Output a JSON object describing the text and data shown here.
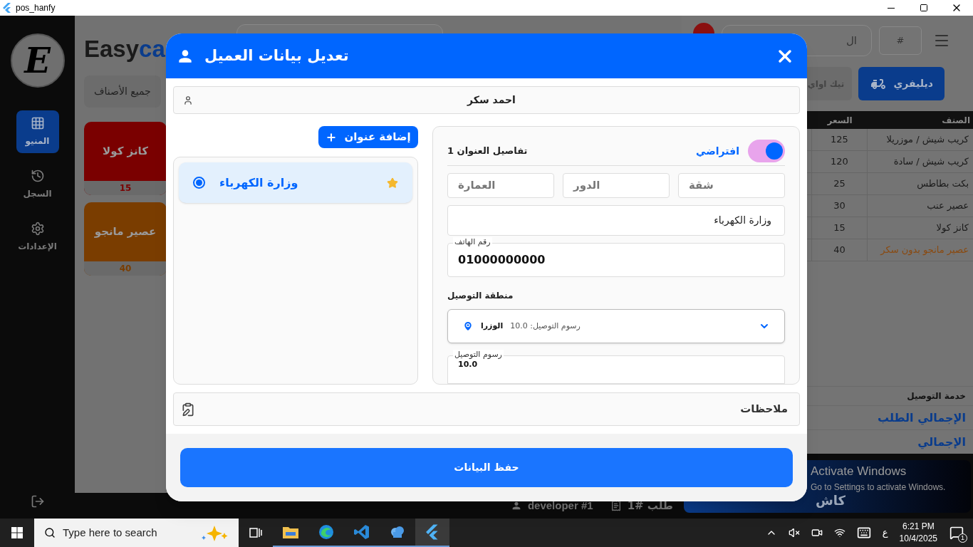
{
  "window": {
    "title": "pos_hanfy"
  },
  "sidebar": {
    "logo_letter": "E",
    "items": [
      {
        "label": "المنيو",
        "kind": "menu",
        "selected": true
      },
      {
        "label": "السجل",
        "kind": "history",
        "selected": false
      },
      {
        "label": "الإعدادات",
        "kind": "settings",
        "selected": false
      }
    ]
  },
  "brand": {
    "part_1": "Easy",
    "part_2": "ca"
  },
  "categories": [
    {
      "label": "جميع الأصناف"
    }
  ],
  "products": [
    {
      "name": "كانز كولا",
      "price": "15",
      "color": "#7a0000"
    },
    {
      "name": "عصير مانجو",
      "price": "40",
      "color": "#7a3d00"
    }
  ],
  "top_bar": {
    "search_text": "ال",
    "number_placeholder": "#"
  },
  "order_types": [
    {
      "label": "ديليفري",
      "selected": true
    },
    {
      "label": "تيك اواي",
      "selected": false
    }
  ],
  "order_table": {
    "columns": [
      "الصنف",
      "السعر"
    ],
    "rows": [
      {
        "item": "كريب شيش / موزريلا",
        "price": "125"
      },
      {
        "item": "كريب شيش / سادة",
        "price": "120"
      },
      {
        "item": "بكت بطاطس",
        "price": "25"
      },
      {
        "item": "عصير عنب",
        "price": "30"
      },
      {
        "item": "كانز كولا",
        "price": "15"
      },
      {
        "item": "عصير مانجو",
        "note": "بدون سكر",
        "price": "40"
      }
    ]
  },
  "totals": [
    {
      "label": "خدمة التوصيل",
      "kind": "line"
    },
    {
      "label": "الإجمالي الطلب",
      "kind": "total"
    },
    {
      "label": "الإجمالي",
      "kind": "total"
    }
  ],
  "pay_button": "كاش",
  "status_bar": {
    "user": "developer #1",
    "order": "طلب #1"
  },
  "dialog": {
    "title": "تعديل بيانات العميل",
    "customer_name": "احمد سكر",
    "add_address_button": "إضافة عنوان",
    "addresses": [
      {
        "name": "وزارة الكهرباء",
        "selected": true,
        "default": true
      }
    ],
    "details": {
      "title": "تفاصيل العنوان 1",
      "default_label": "افتراضي",
      "default_on": true,
      "building_placeholder": "العمارة",
      "floor_placeholder": "الدور",
      "apartment_placeholder": "شقة",
      "address": "وزارة الكهرباء",
      "phone_label": "رقم الهاتف",
      "phone": "01000000000",
      "zone_label": "منطقة التوصيل",
      "zone": {
        "name": "الوزرا",
        "fee": "رسوم التوصيل: 10.0"
      },
      "fee_label": "رسوم التوصيل",
      "fee": "10.0"
    },
    "notes_placeholder": "ملاحظات",
    "save_button": "حفظ البيانات"
  },
  "activation_notice": {
    "title": "Activate Windows",
    "text": "Go to Settings to activate Windows."
  },
  "taskbar": {
    "search_placeholder": "Type here to search",
    "language": "ع",
    "time": "6:21 PM",
    "date": "10/4/2025",
    "notifications": "1"
  }
}
